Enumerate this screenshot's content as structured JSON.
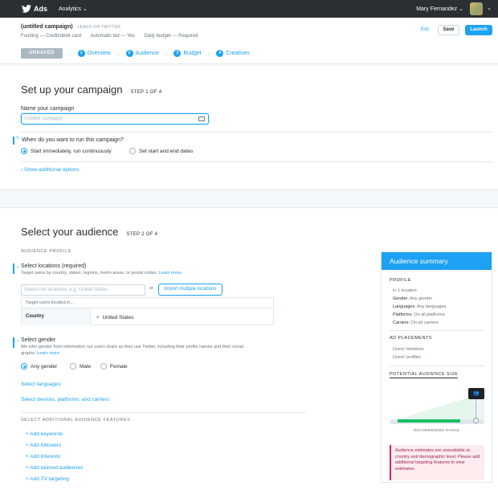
{
  "topbar": {
    "ads": "Ads",
    "analytics": "Analytics",
    "user": "Mary Fernandez"
  },
  "campaign": {
    "title": "(untitled campaign)",
    "source": "LEADS ON TWITTER",
    "meta": [
      "Funding — Credit/debit card",
      "Automatic bid — Yes",
      "Daily budget — Required"
    ],
    "exit": "Exit",
    "save": "Save",
    "launch": "Launch"
  },
  "steps": {
    "unsaved": "UNSAVED",
    "items": [
      {
        "num": "1",
        "label": "Overview"
      },
      {
        "num": "2",
        "label": "Audience"
      },
      {
        "num": "3",
        "label": "Budget"
      },
      {
        "num": "4",
        "label": "Creatives"
      }
    ]
  },
  "setup": {
    "title": "Set up your campaign",
    "step": "STEP 1 OF 4",
    "name_label": "Name your campaign",
    "name_placeholder": "Untitled campaign",
    "question_icon": "?",
    "when_label": "When do you want to run this campaign?",
    "opt_immediate": "Start immediately, run continuously",
    "opt_dates": "Set start and end dates",
    "show_options": "Show additional options"
  },
  "audience": {
    "title": "Select your audience",
    "step": "STEP 2 OF 4",
    "profile_hd": "AUDIENCE PROFILE",
    "locations_label": "Select locations (required)",
    "locations_help": "Target users by country, states, regions, metro areas, or postal codes.",
    "learn_more": "Learn more.",
    "loc_placeholder": "Search for locations, e.g. United States",
    "or": "or",
    "import_btn": "Import multiple locations",
    "table_head": "Target users located in...",
    "table_col": "Country",
    "table_val": "United States",
    "gender_label": "Select gender",
    "gender_help": "We infer gender from information our users share as they use Twitter, including their profile names and their social graphs.",
    "gender_help_l1": "We infer gender from information our users share as they use Twitter, including their profile names and their social",
    "gender_help_l2": "graphs.",
    "gender_any": "Any gender",
    "gender_male": "Male",
    "gender_female": "Female",
    "select_languages": "Select languages",
    "select_devices": "Select devices, platforms, and carriers",
    "additional_hd": "SELECT ADDITIONAL AUDIENCE FEATURES",
    "features": [
      "+ Add keywords",
      "+ Add followers",
      "+ Add interests",
      "+ Add tailored audiences",
      "+ Add TV targeting"
    ]
  },
  "summary": {
    "title": "Audience summary",
    "profile_hd": "PROFILE",
    "location": "In 1 location",
    "gender_k": "Gender:",
    "gender_v": "Any gender",
    "languages_k": "Languages:",
    "languages_v": "Any languages",
    "platforms_k": "Platforms:",
    "platforms_v": "On all platforms",
    "carriers_k": "Carriers:",
    "carriers_v": "On all carriers",
    "placements_hd": "AD PLACEMENTS",
    "placement1": "Users' timelines",
    "placement2": "Users' profiles",
    "potential_hd": "POTENTIAL AUDIENCE SIZE",
    "recommended": "RECOMMENDED RANGE",
    "error": "Audience estimates are unavailable at country and demographic level. Please add additional targeting features to view estimates."
  },
  "colors": {
    "accent": "#1da1f2",
    "topbar": "#292f33",
    "green": "#17bf63",
    "error": "#e0245e"
  }
}
